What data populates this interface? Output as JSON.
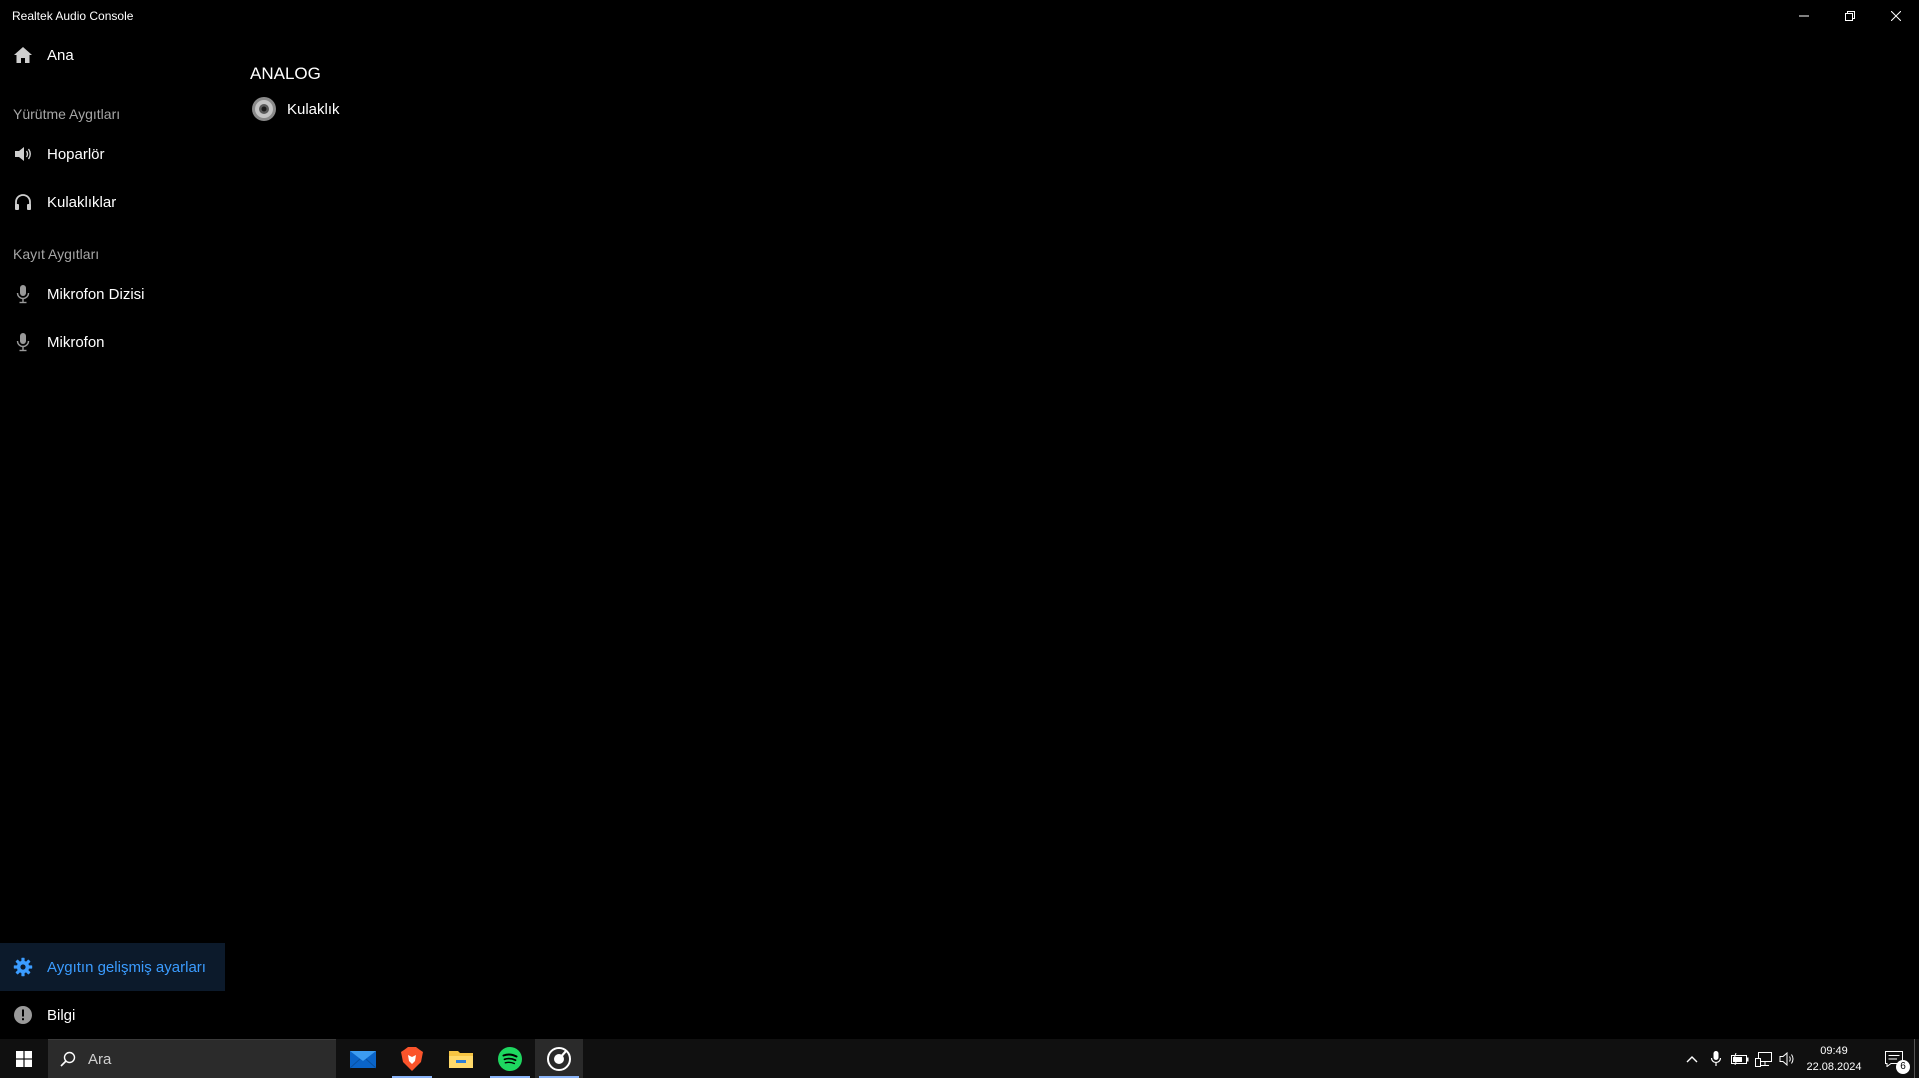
{
  "window": {
    "title": "Realtek Audio Console"
  },
  "sidebar": {
    "home": {
      "label": "Ana",
      "icon": "home-icon"
    },
    "playback_section": "Yürütme Aygıtları",
    "playback_items": [
      {
        "label": "Hoparlör",
        "icon": "speaker-icon"
      },
      {
        "label": "Kulaklıklar",
        "icon": "headphones-icon"
      }
    ],
    "recording_section": "Kayıt Aygıtları",
    "recording_items": [
      {
        "label": "Mikrofon Dizisi",
        "icon": "microphone-icon"
      },
      {
        "label": "Mikrofon",
        "icon": "microphone-icon"
      }
    ],
    "advanced": {
      "label": "Aygıtın gelişmiş ayarları",
      "icon": "gear-icon",
      "active": true
    },
    "info": {
      "label": "Bilgi",
      "icon": "info-icon"
    }
  },
  "main": {
    "section_title": "ANALOG",
    "devices": [
      {
        "label": "Kulaklık",
        "icon": "audio-jack-icon"
      }
    ]
  },
  "taskbar": {
    "search_placeholder": "Ara",
    "apps": [
      "mail-icon",
      "brave-icon",
      "file-explorer-icon",
      "spotify-icon",
      "realtek-icon"
    ],
    "clock_time": "09:49",
    "clock_date": "22.08.2024",
    "notification_count": "6"
  },
  "colors": {
    "accent": "#3b9cff",
    "section_text": "#a6a6a6",
    "background": "#000000"
  }
}
